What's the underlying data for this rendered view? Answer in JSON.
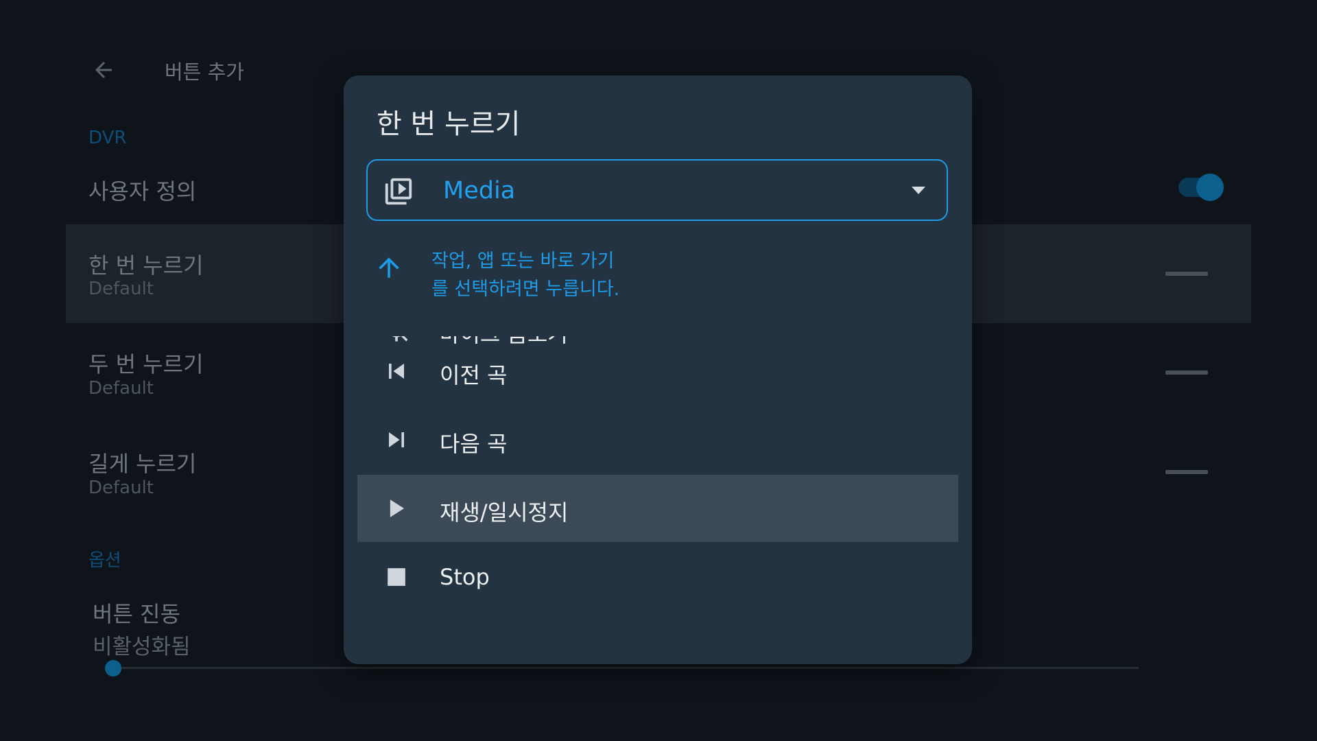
{
  "background": {
    "header": {
      "title": "버튼 추가"
    },
    "sections": [
      {
        "label": "DVR"
      },
      {
        "label": "옵션"
      }
    ],
    "rows": [
      {
        "title": "사용자 정의",
        "subtitle": ""
      },
      {
        "title": "한 번 누르기",
        "subtitle": "Default"
      },
      {
        "title": "두 번 누르기",
        "subtitle": "Default"
      },
      {
        "title": "길게 누르기",
        "subtitle": "Default"
      },
      {
        "title": "버튼 진동",
        "subtitle": "비활성화됨"
      }
    ],
    "toggle": {
      "state": "on"
    },
    "slider": {
      "value": 0
    }
  },
  "dialog": {
    "title": "한 번 누르기",
    "dropdown": {
      "selected": "Media",
      "icon": "media-library-icon"
    },
    "hint": {
      "text": "작업, 앱 또는 바로 가기를 선택하려면 누릅니다.",
      "icon": "arrow-up-icon"
    },
    "items": [
      {
        "label": "마이크 음소거",
        "icon": "mic-off-icon"
      },
      {
        "label": "이전 곡",
        "icon": "skip-previous-icon"
      },
      {
        "label": "다음 곡",
        "icon": "skip-next-icon"
      },
      {
        "label": "재생/일시정지",
        "icon": "play-icon",
        "selected": true
      },
      {
        "label": "Stop",
        "icon": "stop-icon"
      }
    ]
  },
  "colors": {
    "accent": "#1e9be6",
    "dialog_bg": "#233341",
    "selected_row": "#3c4a58",
    "page_bg": "#0f141b"
  }
}
